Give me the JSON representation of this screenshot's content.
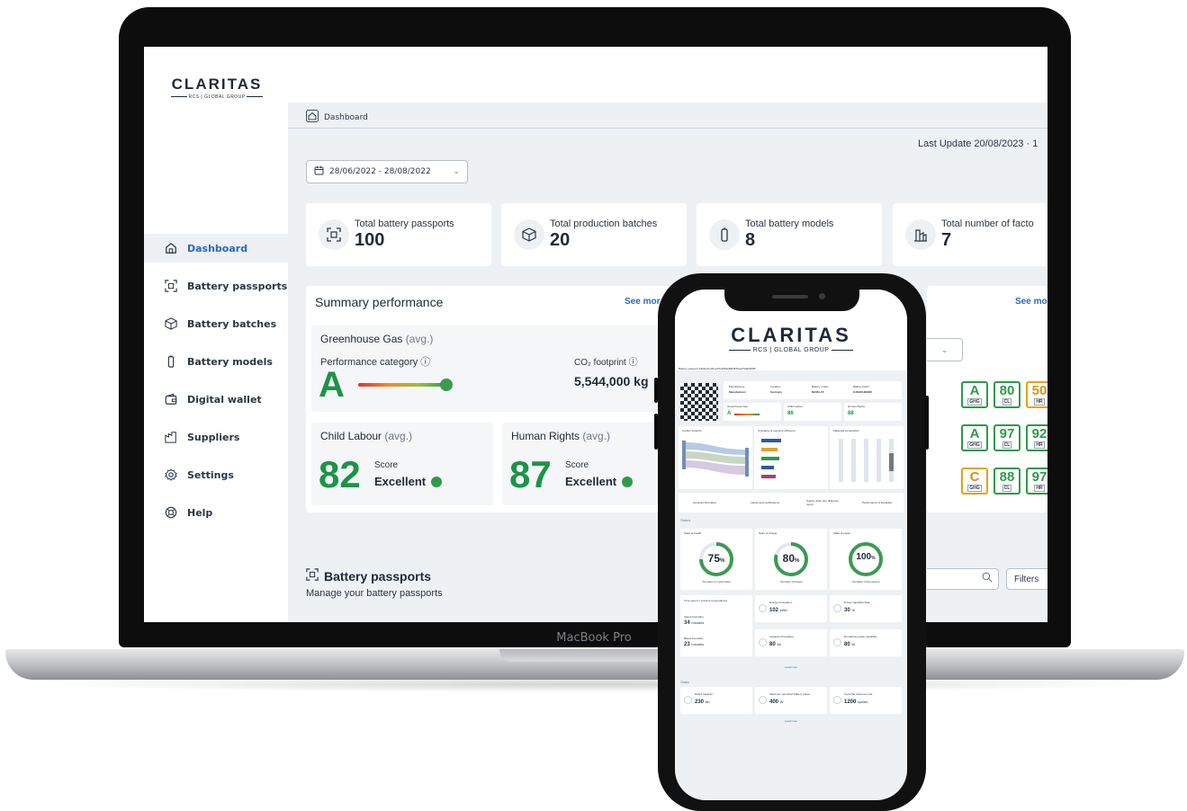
{
  "app": {
    "logo": "CLARITAS",
    "logo_sub": "RCS | GLOBAL GROUP",
    "device_label": "MacBook Pro"
  },
  "sidebar": {
    "items": [
      {
        "label": "Dashboard",
        "icon": "home-icon",
        "active": true
      },
      {
        "label": "Battery passports",
        "icon": "qr-scan-icon"
      },
      {
        "label": "Battery batches",
        "icon": "box-icon"
      },
      {
        "label": "Battery models",
        "icon": "battery-icon"
      },
      {
        "label": "Digital wallet",
        "icon": "wallet-icon"
      },
      {
        "label": "Suppliers",
        "icon": "suppliers-icon"
      },
      {
        "label": "Settings",
        "icon": "gear-icon"
      },
      {
        "label": "Help",
        "icon": "lifebuoy-icon"
      }
    ]
  },
  "header": {
    "breadcrumb": "Dashboard",
    "last_update": "Last Update 20/08/2023 · 1",
    "date_range": "28/06/2022 - 28/08/2022"
  },
  "stats": [
    {
      "label": "Total battery passports",
      "value": "100",
      "icon": "qr-scan-icon"
    },
    {
      "label": "Total production batches",
      "value": "20",
      "icon": "box-icon"
    },
    {
      "label": "Total battery models",
      "value": "8",
      "icon": "battery-icon"
    },
    {
      "label": "Total number of facto",
      "value": "7",
      "icon": "factory-icon"
    }
  ],
  "summary": {
    "title": "Summary performance",
    "see_more": "See mor",
    "ghg_title": "Greenhouse Gas",
    "avg": "(avg.)",
    "performance_category": "Performance category ⓘ",
    "grade": "A",
    "co2_label": "CO₂ footprint ⓘ",
    "co2_value": "5,544,000 kg",
    "child_labour": {
      "title": "Child Labour",
      "avg": "(avg.)",
      "value": "82",
      "score_label": "Score",
      "rating": "Excellent"
    },
    "human_rights": {
      "title": "Human Rights",
      "avg": "(avg.)",
      "value": "87",
      "score_label": "Score",
      "rating": "Excellent"
    }
  },
  "right_panel": {
    "see_more": "See mo",
    "rows": [
      {
        "ghg": "A",
        "cl": "80",
        "hr": "50"
      },
      {
        "ghg": "A",
        "cl": "97",
        "hr": "92"
      },
      {
        "ghg": "C",
        "cl": "88",
        "hr": "97"
      }
    ],
    "ghg_tag": "GHG",
    "cl_tag": "CL",
    "hr_tag": "HR"
  },
  "battery_passports": {
    "title": "Battery passports",
    "subtitle": "Manage your battery passports",
    "filters": "Filters"
  },
  "phone": {
    "logo": "CLARITAS",
    "logo_sub": "RCS | GLOBAL GROUP",
    "passport_id": "Battery passport d4e6ecbe3bee35c49b9a5960f3fcaa79da00b8ff",
    "info_labels": [
      "Manufacturer",
      "Location",
      "Battery model",
      "Battery batch"
    ],
    "info_values": [
      "Manufacturer",
      "Germany",
      "NCMA-FF",
      "KJKHKH98298"
    ],
    "perf_labels": [
      "Greenhouse Gas",
      "Child Labour",
      "Human Rights"
    ],
    "perf_grade": "A",
    "perf_cl": "86",
    "perf_hr": "88",
    "chart_titles": [
      "Carbon footprint",
      "Circularity & resource efficiency",
      "Materials composition"
    ],
    "tabs": [
      "General information",
      "Labels and certifications",
      "Supply chain due diligence report",
      "Performance & Durability"
    ],
    "section_state": "Status",
    "gauges": [
      {
        "title": "State of health",
        "value": "75",
        "unit": "%",
        "note": "The battery is in good shape"
      },
      {
        "title": "State of charge",
        "value": "80",
        "unit": "%",
        "note": "The battery is charged"
      },
      {
        "title": "State of power",
        "value": "100",
        "unit": "%",
        "note": "The battery is fully powered"
      }
    ],
    "temp_title": "Time spent in extreme temperatures",
    "temp_above_label": "Above boundary",
    "temp_above": "34",
    "temp_below_label": "Below boundary",
    "temp_below": "23",
    "temp_unit": "minutes",
    "metrics": [
      {
        "label": "Energy throughput",
        "value": "102",
        "unit": "kWh"
      },
      {
        "label": "Power capability fade",
        "value": "30",
        "unit": "%"
      },
      {
        "label": "Capacity throughput",
        "value": "80",
        "unit": "Ah"
      },
      {
        "label": "Remaining power capability",
        "value": "80",
        "unit": "W"
      }
    ],
    "load_more": "Load more",
    "section_static": "Static",
    "static_metrics": [
      {
        "label": "Rated capacity",
        "value": "230",
        "unit": "Ah"
      },
      {
        "label": "Maximum permitted battery power",
        "value": "400",
        "unit": "W"
      },
      {
        "label": "Cycle life reference test",
        "value": "1200",
        "unit": "cycles"
      }
    ]
  }
}
